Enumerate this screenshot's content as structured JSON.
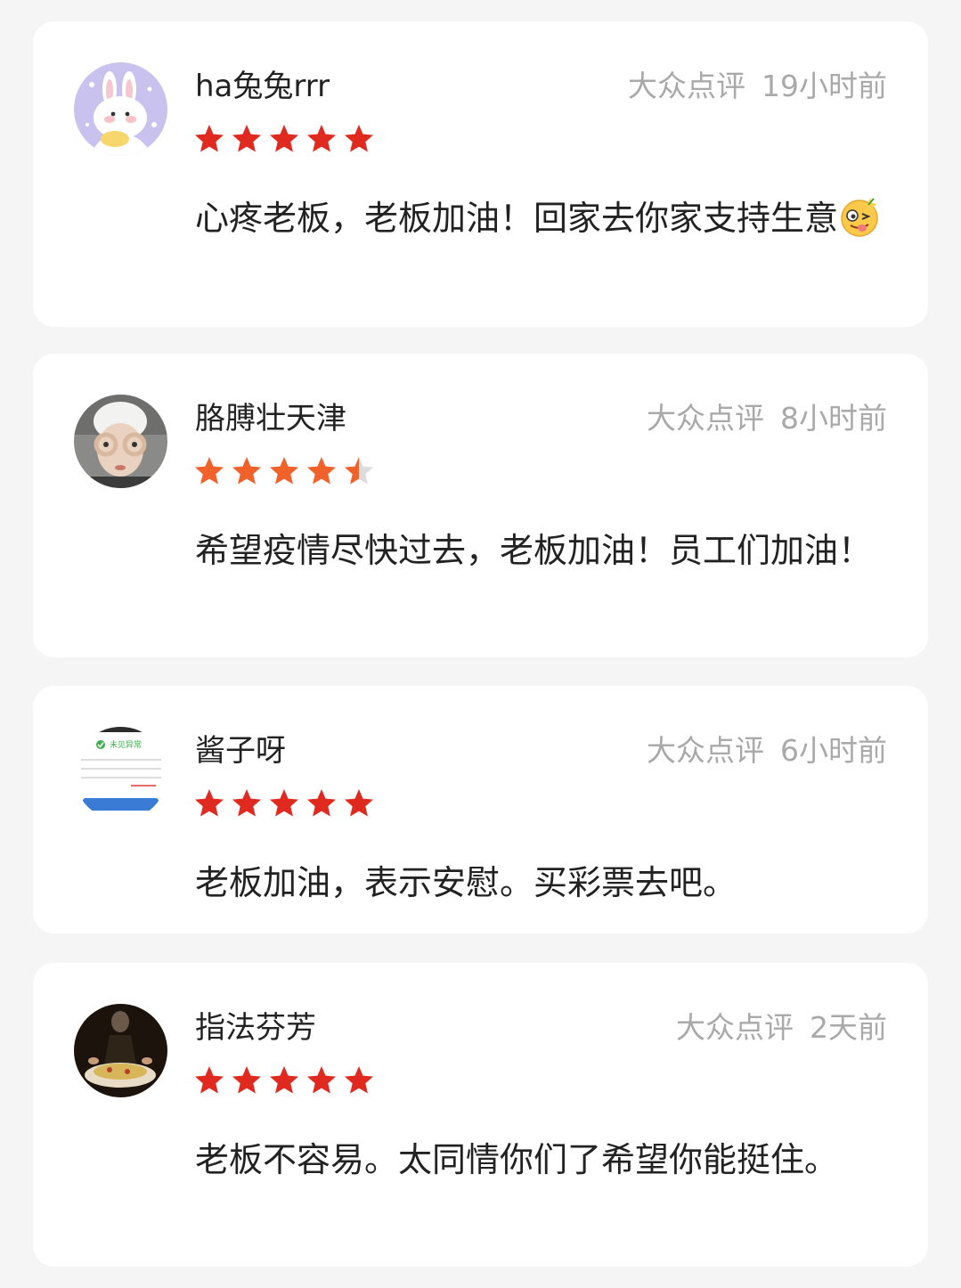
{
  "reviews": [
    {
      "username": "ha兔兔rrr",
      "source": "大众点评",
      "time": "19小时前",
      "rating": 5,
      "star_color": "#e12a1f",
      "comment": "心疼老板，老板加油！回家去你家支持生意",
      "avatar_icon": "bunny-avatar",
      "trailing_emoji": "wink-tongue-emoji"
    },
    {
      "username": "胳膊壮天津",
      "source": "大众点评",
      "time": "8小时前",
      "rating": 4.5,
      "star_color": "#f0622a",
      "comment": "希望疫情尽快过去，老板加油！员工们加油！",
      "avatar_icon": "child-photo-avatar"
    },
    {
      "username": "酱子呀",
      "source": "大众点评",
      "time": "6小时前",
      "rating": 5,
      "star_color": "#e12a1f",
      "comment": "老板加油，表示安慰。买彩票去吧。",
      "avatar_icon": "screenshot-avatar",
      "avatar_text": "未见异常"
    },
    {
      "username": "指法芬芳",
      "source": "大众点评",
      "time": "2天前",
      "rating": 5,
      "star_color": "#e12a1f",
      "comment": "老板不容易。太同情你们了希望你能挺住。",
      "avatar_icon": "dark-food-photo-avatar"
    }
  ]
}
